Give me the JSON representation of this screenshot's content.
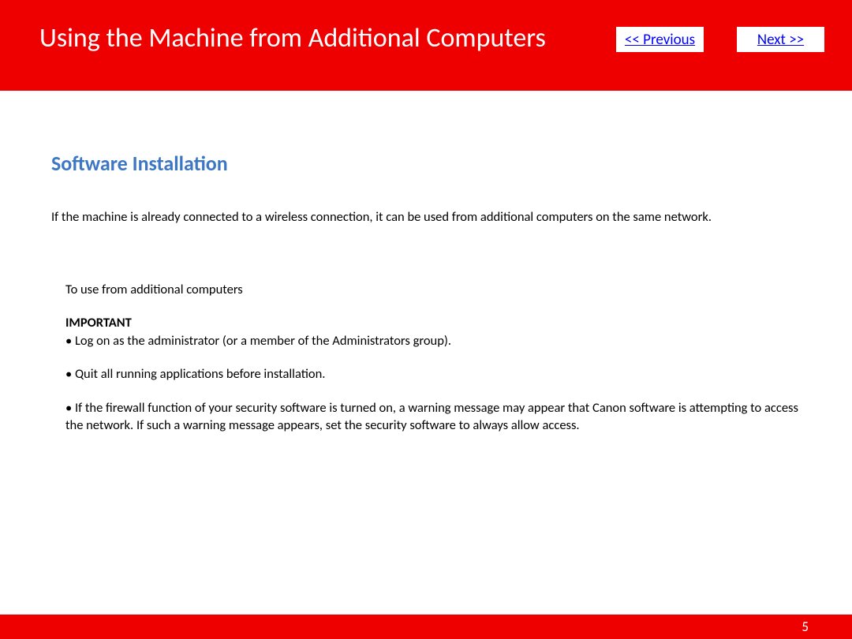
{
  "header": {
    "title": "Using the Machine from Additional Computers",
    "prev_label": "<< Previous",
    "next_label": "Next >>"
  },
  "content": {
    "section_heading": "Software Installation",
    "intro": "If the machine is already connected to a wireless connection, it can be used from additional computers on the same network.",
    "sub_heading": "To use from additional computers",
    "important_label": "IMPORTANT",
    "bullets": {
      "b1": "• Log on as the administrator (or a member of the Administrators group).",
      "b2": "• Quit all running applications before installation.",
      "b3": "• If the firewall function of your security software is turned on, a warning message may appear that Canon software is attempting to access the network. If such a warning message appears, set the security software to always allow access."
    }
  },
  "footer": {
    "page_number": "5"
  }
}
